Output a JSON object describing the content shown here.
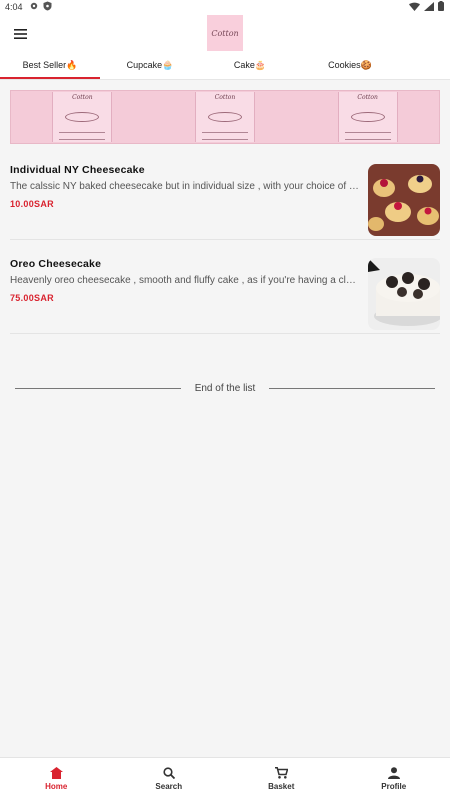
{
  "status_bar": {
    "time": "4:04"
  },
  "header": {
    "logo_text": "Cotton"
  },
  "tabs": [
    {
      "label": "Best Seller🔥"
    },
    {
      "label": "Cupcake🧁"
    },
    {
      "label": "Cake🎂"
    },
    {
      "label": "Cookies🍪"
    }
  ],
  "products": [
    {
      "name": "Individual NY Cheesecake",
      "description": "The calssic NY baked cheesecake but in individual size , with your choice of toppings",
      "price": "10.00SAR"
    },
    {
      "name": "Oreo Cheesecake",
      "description": "Heavenly oreo cheesecake , smooth and fluffy cake , as if you're having a cloud",
      "price": "75.00SAR"
    }
  ],
  "end_of_list": "End of the list",
  "bottom_nav": [
    {
      "label": "Home"
    },
    {
      "label": "Search"
    },
    {
      "label": "Basket"
    },
    {
      "label": "Profile"
    }
  ],
  "colors": {
    "accent": "#d9232f",
    "banner": "#f4cbd8",
    "logo_bg": "#f9cfdc"
  }
}
